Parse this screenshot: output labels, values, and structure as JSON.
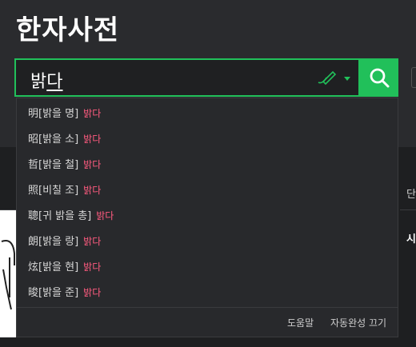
{
  "app": {
    "title": "한자사전"
  },
  "search": {
    "query_part1": "밝",
    "query_part2": "다"
  },
  "suggestions": [
    {
      "text": "明[밝을 명]",
      "match": "밝다"
    },
    {
      "text": "昭[밝을 소]",
      "match": "밝다"
    },
    {
      "text": "哲[밝을 철]",
      "match": "밝다"
    },
    {
      "text": "照[비칠 조]",
      "match": "밝다"
    },
    {
      "text": "聰[귀 밝을 총]",
      "match": "밝다"
    },
    {
      "text": "朗[밝을 랑]",
      "match": "밝다"
    },
    {
      "text": "炫[밝을 현]",
      "match": "밝다"
    },
    {
      "text": "晙[밝을 준]",
      "match": "밝다"
    }
  ],
  "footer": {
    "help": "도움말",
    "autocomplete_off": "자동완성 끄기"
  },
  "side": {
    "text1": "단",
    "text2": "시"
  },
  "colors": {
    "accent": "#21c05a",
    "match": "#ff5b7f"
  },
  "icons": {
    "handwriting": "handwriting-pen-icon",
    "search": "search-icon",
    "dropdown": "caret-down-icon"
  }
}
